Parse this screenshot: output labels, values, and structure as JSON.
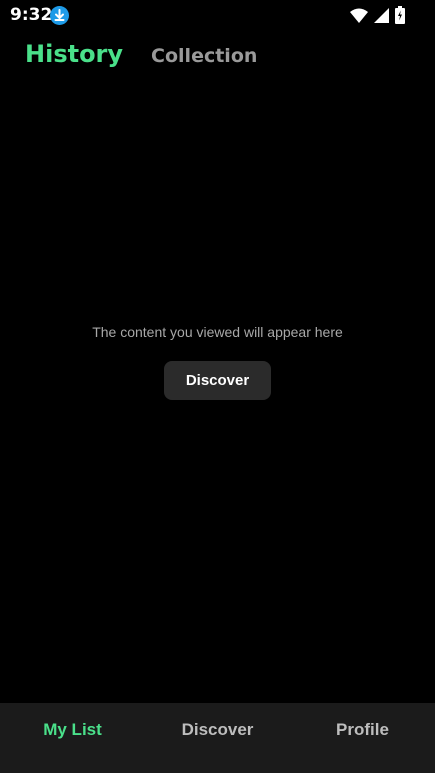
{
  "status_bar": {
    "time": "9:32",
    "icons": [
      "download-icon",
      "wifi-icon",
      "cell-signal-icon",
      "battery-icon"
    ]
  },
  "tabs": [
    {
      "label": "History",
      "active": true
    },
    {
      "label": "Collection",
      "active": false
    }
  ],
  "empty_state": {
    "message": "The content you viewed will appear here",
    "button_label": "Discover"
  },
  "bottom_nav": [
    {
      "label": "My List",
      "active": true
    },
    {
      "label": "Discover",
      "active": false
    },
    {
      "label": "Profile",
      "active": false
    }
  ],
  "colors": {
    "accent": "#4ae08a",
    "background": "#000000",
    "nav_background": "#1b1b1b",
    "button_background": "#2b2b2b",
    "download_badge": "#1e9be8"
  }
}
